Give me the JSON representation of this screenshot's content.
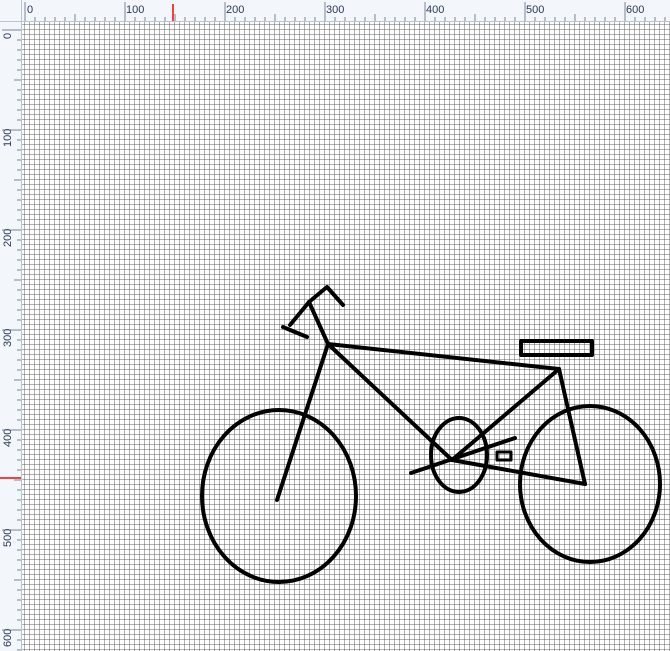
{
  "ruler": {
    "top_labels": [
      "0",
      "100",
      "200",
      "300",
      "400",
      "500",
      "600"
    ],
    "left_labels": [
      "0",
      "100",
      "200",
      "300",
      "400",
      "500",
      "600"
    ]
  },
  "colors": {
    "ruler_bg": "#f3f6fb",
    "ruler_border": "#b9c3d3",
    "ruler_text": "#2b3a55",
    "marker": "#ff0000",
    "stroke": "#000000"
  },
  "canvas": {
    "drawing_subject": "bicycle-icon"
  }
}
